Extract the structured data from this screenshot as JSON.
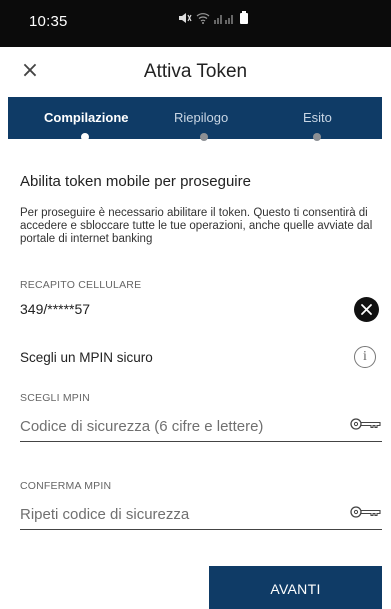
{
  "status_bar": {
    "time": "10:35"
  },
  "header": {
    "title": "Attiva Token",
    "close_icon": "close-icon"
  },
  "stepper": {
    "steps": [
      {
        "label": "Compilazione",
        "active": true
      },
      {
        "label": "Riepilogo",
        "active": false
      },
      {
        "label": "Esito",
        "active": false
      }
    ]
  },
  "content": {
    "title": "Abilita token mobile per proseguire",
    "description": "Per proseguire è necessario abilitare il token. Questo ti consentirà di accedere e sbloccare tutte le tue operazioni, anche quelle avviate dal portale di internet banking"
  },
  "phone": {
    "label": "RECAPITO CELLULARE",
    "value": "349/*****57"
  },
  "mpin": {
    "section_label": "Scegli un MPIN sicuro",
    "choose_label": "SCEGLI MPIN",
    "choose_placeholder": "Codice di sicurezza (6 cifre e lettere)",
    "confirm_label": "CONFERMA MPIN",
    "confirm_placeholder": "Ripeti codice di sicurezza"
  },
  "actions": {
    "next_label": "AVANTI"
  },
  "colors": {
    "primary": "#0f3b66",
    "statusbar": "#0b0b0b"
  }
}
